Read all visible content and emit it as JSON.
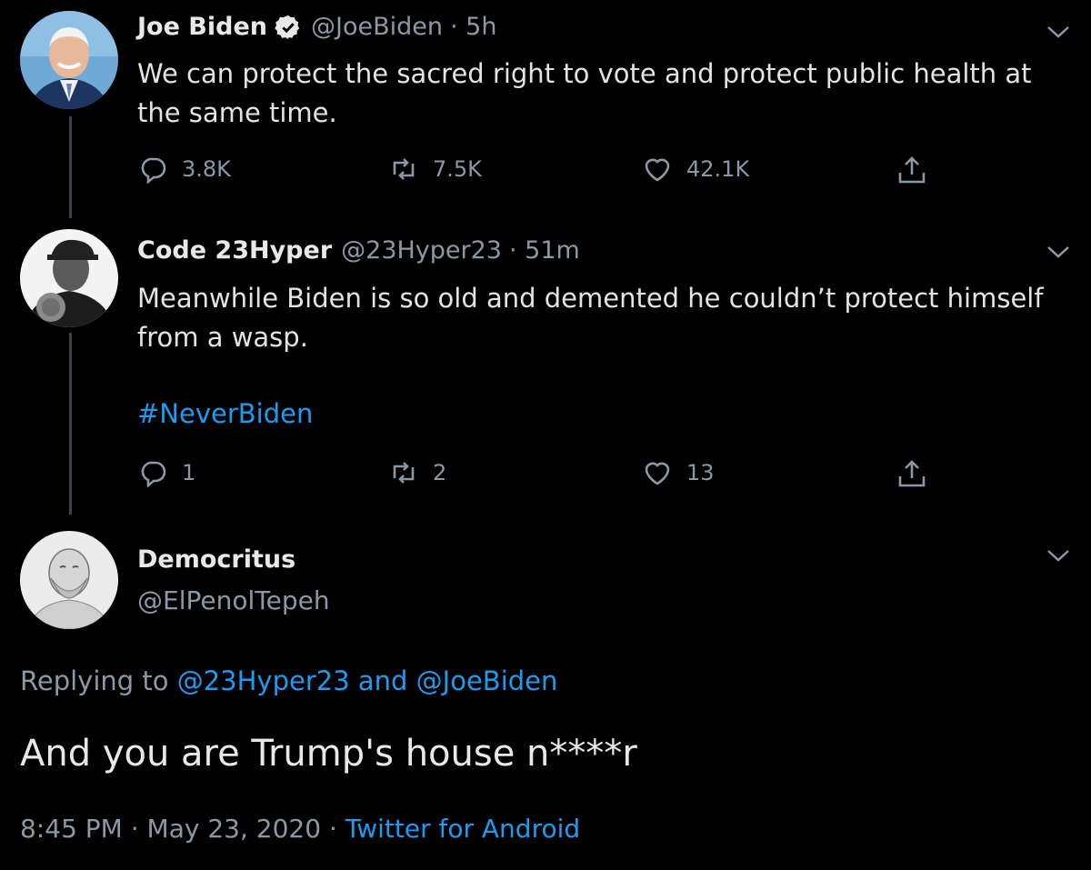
{
  "tweets": [
    {
      "name": "Joe Biden",
      "verified": true,
      "handle": "@JoeBiden",
      "time": "· 5h",
      "text": "We can protect the sacred right to vote and protect public health at the same time.",
      "replies": "3.8K",
      "retweets": "7.5K",
      "likes": "42.1K"
    },
    {
      "name": "Code 23Hyper",
      "handle": "@23Hyper23",
      "time": "· 51m",
      "text": "Meanwhile Biden is so old and demented he couldn’t protect himself from a wasp.",
      "hashtag": "#NeverBiden",
      "replies": "1",
      "retweets": "2",
      "likes": "13"
    }
  ],
  "focused": {
    "name": "Democritus",
    "handle": "@ElPenolTepeh",
    "replying_prefix": "Replying to",
    "reply_to_1": "@23Hyper23",
    "reply_and": "and",
    "reply_to_2": "@JoeBiden",
    "text": "And you are Trump's house n****r",
    "time": "8:45 PM",
    "sep": "·",
    "date": "May 23, 2020",
    "source": "Twitter for Android"
  },
  "icons": {
    "reply": "reply-icon",
    "retweet": "retweet-icon",
    "like": "heart-icon",
    "share": "share-icon",
    "more": "chevron-down-icon",
    "verified": "verified-badge-icon"
  },
  "colors": {
    "background": "#000000",
    "text": "#d9d9d9",
    "muted": "#8b98a5",
    "link": "#1d9bf0",
    "thread_line": "#3d4348"
  }
}
